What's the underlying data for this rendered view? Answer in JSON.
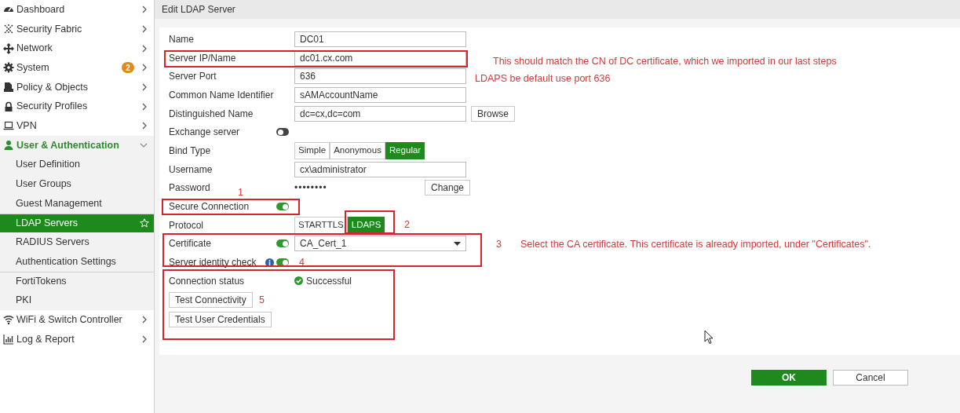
{
  "sidebar": {
    "items": [
      {
        "label": "Dashboard",
        "expanded": false,
        "selected": false
      },
      {
        "label": "Security Fabric",
        "expanded": false,
        "selected": false
      },
      {
        "label": "Network",
        "expanded": false,
        "selected": false
      },
      {
        "label": "System",
        "badge": "2",
        "expanded": false,
        "selected": false
      },
      {
        "label": "Policy & Objects",
        "expanded": false,
        "selected": false
      },
      {
        "label": "Security Profiles",
        "expanded": false,
        "selected": false
      },
      {
        "label": "VPN",
        "expanded": false,
        "selected": false
      },
      {
        "label": "User & Authentication",
        "expanded": true,
        "selected": true,
        "children": [
          {
            "label": "User Definition",
            "selected": false,
            "divider_above": false
          },
          {
            "label": "User Groups",
            "selected": false,
            "divider_above": false
          },
          {
            "label": "Guest Management",
            "selected": false,
            "divider_above": false
          },
          {
            "label": "LDAP Servers",
            "selected": true,
            "divider_above": true
          },
          {
            "label": "RADIUS Servers",
            "selected": false,
            "divider_above": false
          },
          {
            "label": "Authentication Settings",
            "selected": false,
            "divider_above": false
          },
          {
            "label": "FortiTokens",
            "selected": false,
            "divider_above": true
          },
          {
            "label": "PKI",
            "selected": false,
            "divider_above": false
          }
        ]
      },
      {
        "label": "WiFi & Switch Controller",
        "expanded": false,
        "selected": false
      },
      {
        "label": "Log & Report",
        "expanded": false,
        "selected": false
      }
    ]
  },
  "page_title": "Edit LDAP Server",
  "fields": [
    {
      "kind": "input",
      "label": "Name",
      "value": "DC01"
    },
    {
      "kind": "input",
      "label": "Server IP/Name",
      "value": "dc01.cx.com"
    },
    {
      "kind": "input",
      "label": "Server Port",
      "value": "636"
    },
    {
      "kind": "input",
      "label": "Common Name Identifier",
      "value": "sAMAccountName"
    },
    {
      "kind": "input",
      "label": "Distinguished Name",
      "value": "dc=cx,dc=com",
      "button": "Browse"
    },
    {
      "kind": "toggle",
      "label": "Exchange server",
      "on": false
    },
    {
      "kind": "segmented",
      "label": "Bind Type",
      "options": [
        {
          "label": "Simple",
          "selected": false
        },
        {
          "label": "Anonymous",
          "selected": false
        },
        {
          "label": "Regular",
          "selected": true
        }
      ]
    },
    {
      "kind": "input",
      "label": "Username",
      "value": "cx\\administrator"
    },
    {
      "kind": "password",
      "label": "Password",
      "value": "••••••••",
      "button": "Change"
    },
    {
      "kind": "toggle",
      "label": "Secure Connection",
      "on": true
    },
    {
      "kind": "segmented",
      "label": "Protocol",
      "options": [
        {
          "label": "STARTTLS",
          "selected": false
        },
        {
          "label": "LDAPS",
          "selected": true
        }
      ]
    },
    {
      "kind": "toggle_select",
      "label": "Certificate",
      "on": true,
      "value": "CA_Cert_1"
    },
    {
      "kind": "toggle",
      "label": "Server identity check",
      "on": true,
      "info": true
    },
    {
      "kind": "status",
      "label": "Connection status",
      "value": "Successful"
    },
    {
      "kind": "button",
      "label": "Test Connectivity"
    },
    {
      "kind": "button",
      "label": "Test User Credentials"
    }
  ],
  "annotations": [
    {
      "text": "This should match the CN of DC certificate, which we imported in our last steps"
    },
    {
      "text": "LDAPS be default use port 636"
    },
    {
      "text": "1"
    },
    {
      "text": "2"
    },
    {
      "text": "3"
    },
    {
      "text": "Select the CA certificate. This certificate is already imported, under \"Certificates\"."
    },
    {
      "text": "4"
    },
    {
      "text": "5"
    }
  ],
  "buttons": [
    {
      "label": "OK",
      "kind": "primary"
    },
    {
      "label": "Cancel",
      "kind": "secondary"
    }
  ]
}
